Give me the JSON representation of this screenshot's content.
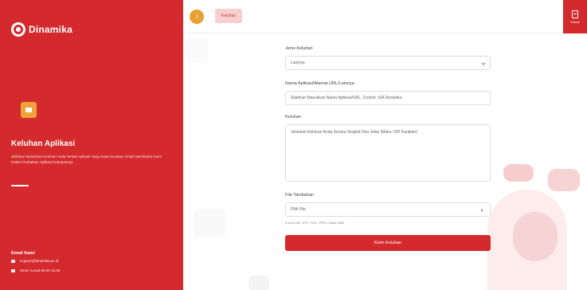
{
  "brand": {
    "logo_text": "Dinamika"
  },
  "sidebar": {
    "title": "Keluhan Aplikasi",
    "description": "Silahkan Masukkan Keluhan Anda Terkait Aplikasi Yang Anda Gunakan Untuk Membantu Kami Dalam Perbaikan Aplikasi Kedepannya",
    "contact_title": "Email Kami",
    "contact_email": "support@dinamika.ac.id",
    "contact_phone": "Senin-Jumat 08.00-16.00"
  },
  "topbar": {
    "avatar_initial": "J",
    "tab_label": "Keluhan",
    "logout_label": "Keluar"
  },
  "form": {
    "type_label": "Jenis Keluhan",
    "type_value": "Lainnya",
    "app_label": "Nama Aplikasi/Alamat URL/Lainnya",
    "app_placeholder": "Silahkan Masukkan Nama Aplikasi/URL, Contoh: SIA Dinamika",
    "complaint_label": "Keluhan",
    "complaint_placeholder": "Jelaskan Keluhan Anda Secara Singkat Dan Jelas (Maks. 500 Karakter)",
    "file_label": "File Tambahan",
    "file_button": "Pilih File",
    "file_hint": "Format file: JPG, PNG, JPEG. Maks 2MB",
    "submit_label": "Kirim Keluhan"
  },
  "colors": {
    "brand_red": "#d42a2d",
    "accent_orange": "#e8a030",
    "tab_bg": "#f7cfcf"
  }
}
